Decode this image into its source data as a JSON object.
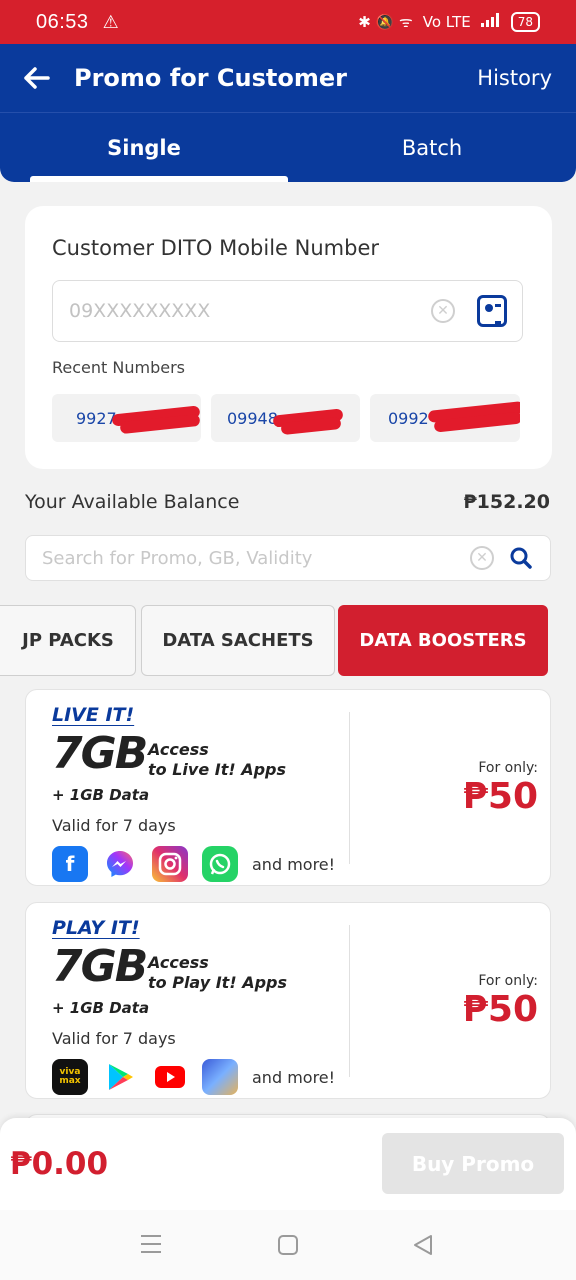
{
  "status_bar": {
    "time": "06:53",
    "warning_glyph": "⚠",
    "icons_text": "✱ 🔕 ᯤ",
    "network": "Vo LTE",
    "battery": "78"
  },
  "header": {
    "title": "Promo for Customer",
    "history_label": "History"
  },
  "tabs": [
    {
      "label": "Single",
      "active": true
    },
    {
      "label": "Batch",
      "active": false
    }
  ],
  "customer": {
    "label": "Customer DITO Mobile Number",
    "placeholder": "09XXXXXXXXX",
    "recent_label": "Recent Numbers",
    "recent_numbers": [
      "9927",
      "09948",
      "0992"
    ]
  },
  "balance": {
    "label": "Your Available Balance",
    "value": "₱152.20"
  },
  "search": {
    "placeholder": "Search for Promo, GB, Validity"
  },
  "categories": [
    {
      "label": "JP PACKS",
      "active": false
    },
    {
      "label": "DATA SACHETS",
      "active": false
    },
    {
      "label": "DATA BOOSTERS",
      "active": true
    }
  ],
  "promos": [
    {
      "name": "LIVE IT!",
      "big": "7GB",
      "access_line1": "Access",
      "access_line2": "to Live It! Apps",
      "extra": "+ 1GB Data",
      "validity": "Valid for 7 days",
      "apps": [
        "facebook-icon",
        "messenger-icon",
        "instagram-icon",
        "whatsapp-icon"
      ],
      "more": "and more!",
      "for_only": "For only:",
      "price": "₱50"
    },
    {
      "name": "PLAY IT!",
      "big": "7GB",
      "access_line1": "Access",
      "access_line2": "to Play It! Apps",
      "extra": "+ 1GB Data",
      "validity": "Valid for 7 days",
      "apps": [
        "vivamax-icon",
        "google-play-icon",
        "youtube-icon",
        "mobile-legends-icon"
      ],
      "more": "and more!",
      "for_only": "For only:",
      "price": "₱50"
    }
  ],
  "footer": {
    "total": "₱0.00",
    "buy_label": "Buy Promo"
  },
  "app_labels": {
    "vivamax": "viva max"
  },
  "colors": {
    "brand_blue": "#0a3a9c",
    "brand_red": "#d21f2f",
    "status_red": "#d6202c"
  }
}
